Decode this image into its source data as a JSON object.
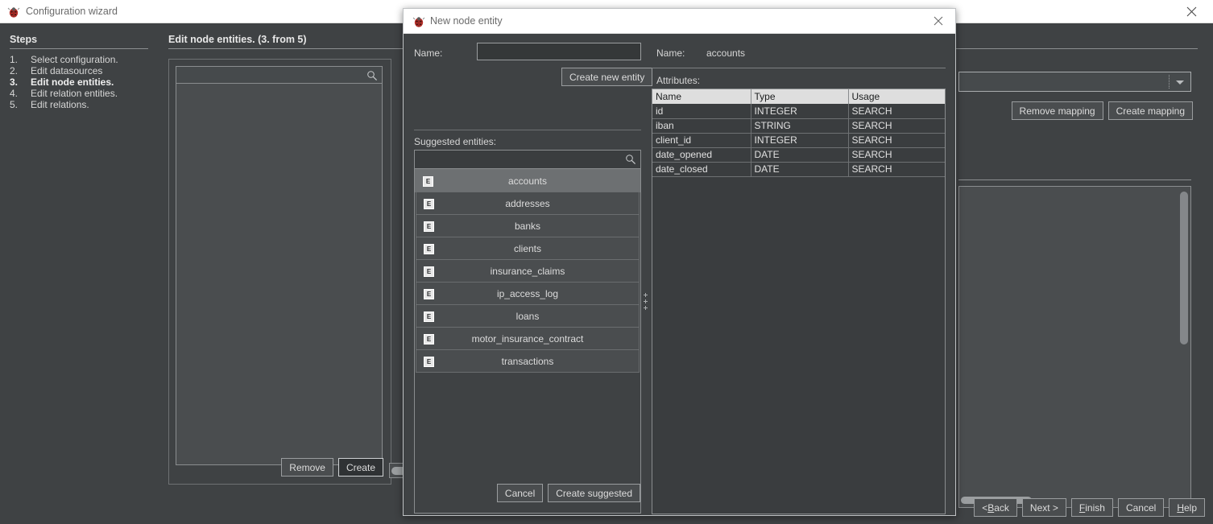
{
  "window": {
    "title": "Configuration wizard",
    "icon": "ladybug-icon",
    "close_glyph": "✕"
  },
  "steps": {
    "heading": "Steps",
    "items": [
      {
        "num": "1.",
        "label": "Select configuration.",
        "current": false
      },
      {
        "num": "2.",
        "label": "Edit datasources",
        "current": false
      },
      {
        "num": "3.",
        "label": "Edit node entities.",
        "current": true
      },
      {
        "num": "4.",
        "label": "Edit relation entities.",
        "current": false
      },
      {
        "num": "5.",
        "label": "Edit relations.",
        "current": false
      }
    ]
  },
  "content": {
    "heading": "Edit node entities. (3. from 5)",
    "left_pane": {
      "search_placeholder": "",
      "search_value": "",
      "search_icon": "search-icon",
      "remove_label": "Remove",
      "create_label": "Create"
    },
    "right_pane": {
      "combo_value": "",
      "remove_mapping_label": "Remove mapping",
      "create_mapping_label": "Create mapping"
    }
  },
  "wizard_buttons": [
    {
      "name": "back",
      "pre": "< ",
      "mnemonic": "B",
      "post": "ack"
    },
    {
      "name": "next",
      "pre": "Next >",
      "mnemonic": "",
      "post": ""
    },
    {
      "name": "finish",
      "pre": "",
      "mnemonic": "F",
      "post": "inish"
    },
    {
      "name": "cancel",
      "pre": "Cancel",
      "mnemonic": "",
      "post": ""
    },
    {
      "name": "help",
      "pre": "",
      "mnemonic": "H",
      "post": "elp"
    }
  ],
  "dialog": {
    "title": "New node entity",
    "icon": "ladybug-icon",
    "close_glyph": "✕",
    "left": {
      "name_label": "Name:",
      "name_value": "",
      "name_placeholder": "",
      "create_new_entity_label": "Create new entity",
      "suggested_label": "Suggested entities:",
      "suggested_search_value": "",
      "suggested_search_icon": "search-icon",
      "suggested_entities": [
        {
          "label": "accounts",
          "badge": "E",
          "selected": true
        },
        {
          "label": "addresses",
          "badge": "E",
          "selected": false
        },
        {
          "label": "banks",
          "badge": "E",
          "selected": false
        },
        {
          "label": "clients",
          "badge": "E",
          "selected": false
        },
        {
          "label": "insurance_claims",
          "badge": "E",
          "selected": false
        },
        {
          "label": "ip_access_log",
          "badge": "E",
          "selected": false
        },
        {
          "label": "loans",
          "badge": "E",
          "selected": false
        },
        {
          "label": "motor_insurance_contract",
          "badge": "E",
          "selected": false
        },
        {
          "label": "transactions",
          "badge": "E",
          "selected": false
        }
      ],
      "cancel_label": "Cancel",
      "create_suggested_label": "Create suggested"
    },
    "right": {
      "name_label": "Name:",
      "name_value": "accounts",
      "attributes_label": "Attributes:",
      "columns": [
        "Name",
        "Type",
        "Usage"
      ],
      "rows": [
        [
          "id",
          "INTEGER",
          "SEARCH"
        ],
        [
          "iban",
          "STRING",
          "SEARCH"
        ],
        [
          "client_id",
          "INTEGER",
          "SEARCH"
        ],
        [
          "date_opened",
          "DATE",
          "SEARCH"
        ],
        [
          "date_closed",
          "DATE",
          "SEARCH"
        ]
      ]
    }
  },
  "colors": {
    "window_bg": "#3f4244",
    "panel_bg": "#4a4d4f",
    "selection_bg": "#6d7072",
    "titlebar_bg": "#ffffff",
    "text": "#d6d6d6",
    "header_row_bg": "#dedede",
    "accent_icon_red": "#b4302a"
  }
}
